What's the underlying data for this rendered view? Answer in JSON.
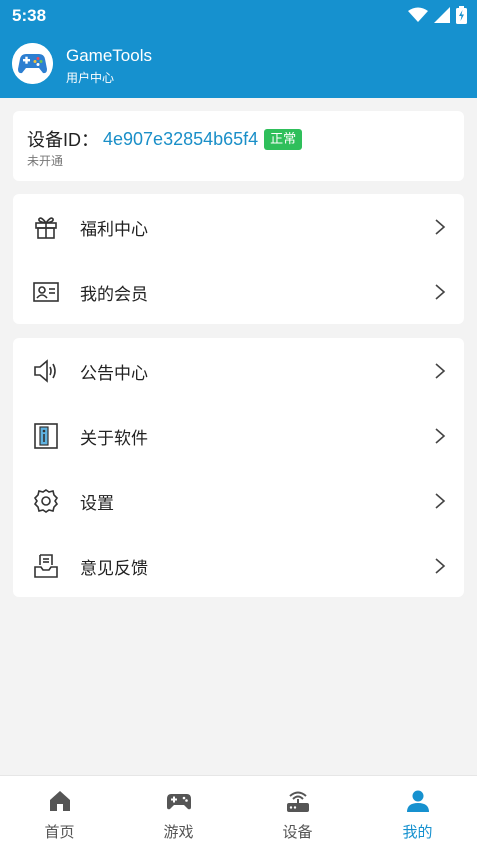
{
  "status_bar": {
    "time": "5:38"
  },
  "app": {
    "title": "GameTools",
    "subtitle": "用户中心"
  },
  "device": {
    "label": "设备ID：",
    "id": "4e907e32854b65f4",
    "badge": "正常",
    "status": "未开通"
  },
  "menu_group_1": [
    {
      "label": "福利中心",
      "icon": "gift-icon"
    },
    {
      "label": "我的会员",
      "icon": "member-card-icon"
    }
  ],
  "menu_group_2": [
    {
      "label": "公告中心",
      "icon": "speaker-icon"
    },
    {
      "label": "关于软件",
      "icon": "info-icon"
    },
    {
      "label": "设置",
      "icon": "gear-icon"
    },
    {
      "label": "意见反馈",
      "icon": "inbox-icon"
    }
  ],
  "bottom_nav": [
    {
      "label": "首页",
      "icon": "home-icon"
    },
    {
      "label": "游戏",
      "icon": "gamepad-icon"
    },
    {
      "label": "设备",
      "icon": "router-icon"
    },
    {
      "label": "我的",
      "icon": "user-icon",
      "active": true
    }
  ],
  "colors": {
    "primary": "#1691cf",
    "badge": "#2fbf5b",
    "device_id": "#1a8fc8",
    "background": "#f3f3f3"
  }
}
